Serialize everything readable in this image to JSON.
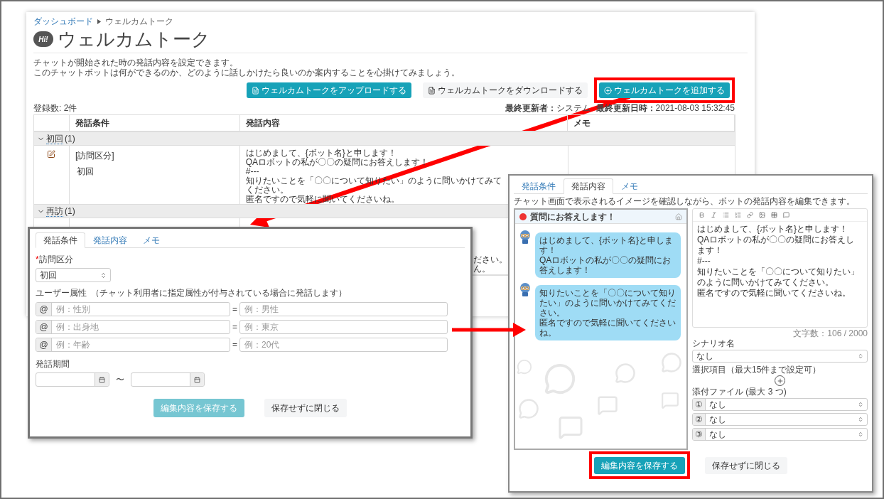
{
  "page": {
    "breadcrumb": [
      {
        "label": "ダッシュボード",
        "kind": "link"
      },
      {
        "label": "ウェルカムトーク",
        "kind": "current"
      }
    ],
    "title_icon_text": "Hi!",
    "title": "ウェルカムトーク",
    "description": [
      "チャットが開始された時の発話内容を設定できます。",
      "このチャットボットは何ができるのか、どのように話しかけたら良いのか案内することを心掛けてみましょう。"
    ],
    "buttons": [
      {
        "label": "ウェルカムトークをアップロードする",
        "kind": "primary",
        "highlighted": false
      },
      {
        "label": "ウェルカムトークをダウンロードする",
        "kind": "secondary",
        "highlighted": false
      },
      {
        "label": "ウェルカムトークを追加する",
        "kind": "primary",
        "highlighted": true
      }
    ],
    "count": "登録数: 2件",
    "updated": [
      {
        "label": "最終更新者：",
        "value": "システム"
      },
      {
        "label": "最終更新日時：",
        "value": "2021-08-03 15:32:45"
      }
    ],
    "table": {
      "columns": [
        "発話条件",
        "発話内容",
        "メモ"
      ],
      "groups": [
        {
          "label": "初回",
          "count": "(1)",
          "expanded": true,
          "rows": [
            {
              "condition_label": "[訪問区分]",
              "condition_value": "初回",
              "content": [
                "はじめまして、{ボット名}と申します！",
                "QAロボットの私が〇〇の疑問にお答えします！",
                "#---",
                "知りたいことを「〇〇について知りたい」のように問いかけてみてください。",
                "匿名ですので気軽に聞いてくださいね。"
              ]
            }
          ]
        },
        {
          "label": "再訪",
          "count": "(1)",
          "expanded": true,
          "rows": [
            {
              "content": [
                "ださい。",
                "ん。"
              ]
            }
          ]
        }
      ]
    }
  },
  "condition_editor": {
    "tabs": [
      {
        "label": "発話条件",
        "selected": true
      },
      {
        "label": "発話内容",
        "selected": false
      },
      {
        "label": "メモ",
        "selected": false
      }
    ],
    "visit_type": {
      "required_mark": "*",
      "label": "訪問区分",
      "value": "初回"
    },
    "user_attributes": {
      "label": "ユーザー属性",
      "note": "（チャット利用者に指定属性が付与されている場合に発話します）",
      "rows": [
        {
          "prefix": "@",
          "key_placeholder": "例：性別",
          "separator": "=",
          "value_placeholder": "例：男性"
        },
        {
          "prefix": "@",
          "key_placeholder": "例：出身地",
          "separator": "=",
          "value_placeholder": "例：東京"
        },
        {
          "prefix": "@",
          "key_placeholder": "例：年齢",
          "separator": "=",
          "value_placeholder": "例：20代"
        }
      ]
    },
    "period": {
      "label": "発話期間",
      "separator": "〜"
    },
    "buttons": [
      {
        "label": "編集内容を保存する",
        "kind": "primary",
        "disabled": true,
        "highlighted": false
      },
      {
        "label": "保存せずに閉じる",
        "kind": "secondary",
        "highlighted": false
      }
    ]
  },
  "content_editor": {
    "tabs": [
      {
        "label": "発話条件",
        "selected": false
      },
      {
        "label": "発話内容",
        "selected": true
      },
      {
        "label": "メモ",
        "selected": false
      }
    ],
    "hint": "チャット画面で表示されるイメージを確認しながら、ボットの発話内容を編集できます。",
    "preview": {
      "title": "質問にお答えします！",
      "messages": [
        {
          "lines": [
            "はじめまして、{ボット名}と申します！",
            "QAロボットの私が〇〇の疑問にお答えします！"
          ]
        },
        {
          "lines": [
            "知りたいことを「〇〇について知りたい」のように問いかけてみてください。",
            "匿名ですので気軽に聞いてくださいね。"
          ]
        }
      ]
    },
    "body": [
      "はじめまして、{ボット名}と申します！",
      "QAロボットの私が〇〇の疑問にお答えします！",
      "#---",
      "知りたいことを「〇〇について知りたい」のように問いかけてみてください。",
      "匿名ですので気軽に聞いてくださいね。"
    ],
    "char_count": "文字数：106 / 2000",
    "scenario": {
      "label": "シナリオ名",
      "value": "なし"
    },
    "choices": {
      "label": "選択項目（最大15件まで設定可）"
    },
    "attachments": {
      "label": "添付ファイル (最大 3 つ)",
      "items": [
        {
          "marker": "①",
          "value": "なし"
        },
        {
          "marker": "②",
          "value": "なし"
        },
        {
          "marker": "③",
          "value": "なし"
        }
      ]
    },
    "buttons": [
      {
        "label": "編集内容を保存する",
        "kind": "primary",
        "disabled": false,
        "highlighted": true
      },
      {
        "label": "保存せずに閉じる",
        "kind": "secondary",
        "highlighted": false
      }
    ]
  }
}
